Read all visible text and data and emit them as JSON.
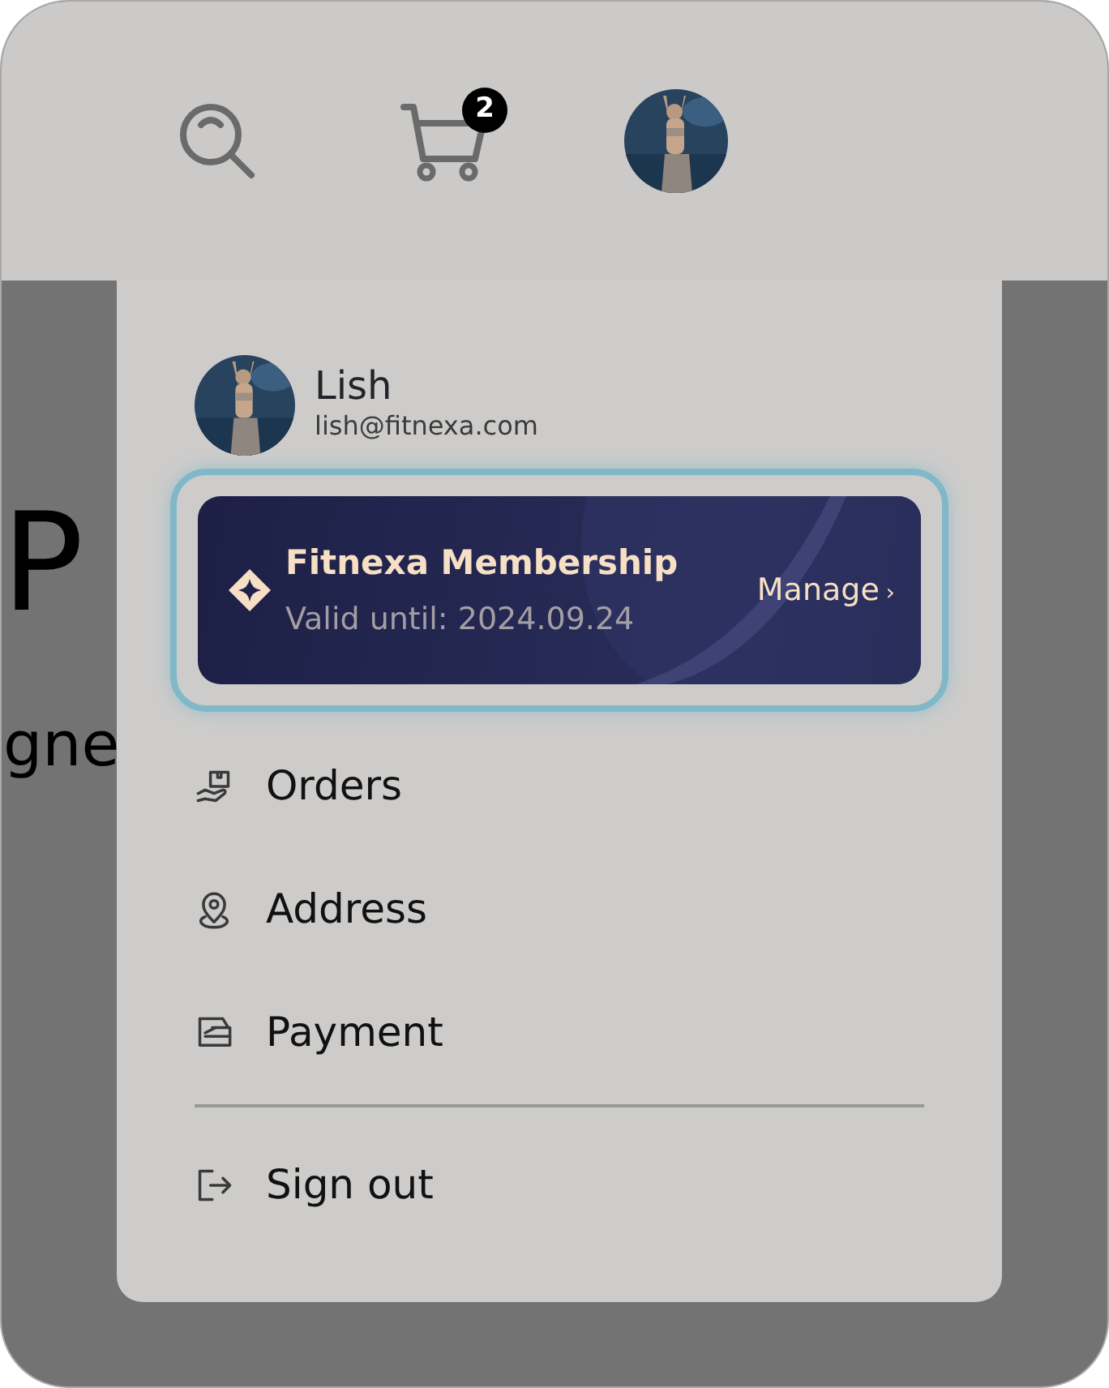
{
  "header": {
    "cart_count": "2"
  },
  "background": {
    "heading": "P",
    "subheading": "gne"
  },
  "profile": {
    "name": "Lish",
    "email": "lish@fitnexa.com"
  },
  "membership": {
    "title": "Fitnexa Membership",
    "valid": "Valid until: 2024.09.24",
    "action": "Manage",
    "chevron": "›",
    "highlighted": true
  },
  "menu": [
    {
      "kind": "orders",
      "label": "Orders"
    },
    {
      "kind": "address",
      "label": "Address"
    },
    {
      "kind": "payment",
      "label": "Payment"
    }
  ],
  "sign_out": {
    "kind": "signout",
    "label": "Sign out"
  }
}
